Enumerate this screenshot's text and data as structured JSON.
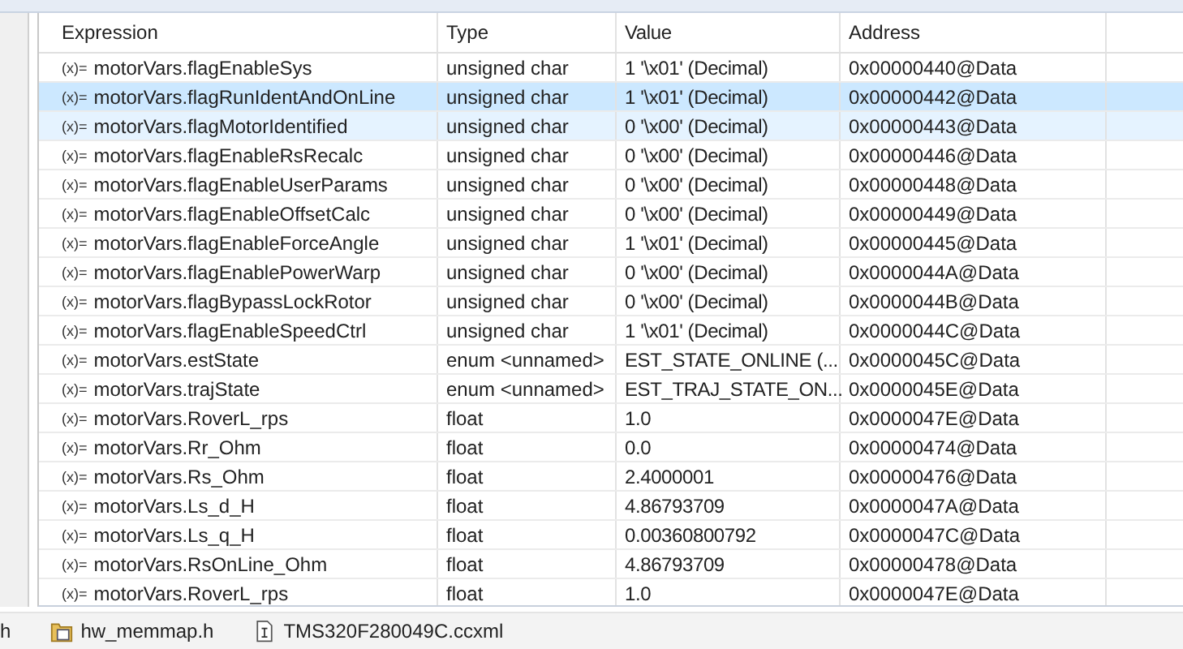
{
  "table": {
    "columns": [
      "Expression",
      "Type",
      "Value",
      "Address"
    ],
    "rows": [
      {
        "marker": "(x)=",
        "expression": "motorVars.flagEnableSys",
        "type": "unsigned char",
        "value": "1 '\\x01' (Decimal)",
        "address": "0x00000440@Data",
        "selected": false,
        "hovered": false
      },
      {
        "marker": "(x)=",
        "expression": "motorVars.flagRunIdentAndOnLine",
        "type": "unsigned char",
        "value": "1 '\\x01' (Decimal)",
        "address": "0x00000442@Data",
        "selected": true,
        "hovered": false
      },
      {
        "marker": "(x)=",
        "expression": "motorVars.flagMotorIdentified",
        "type": "unsigned char",
        "value": "0 '\\x00' (Decimal)",
        "address": "0x00000443@Data",
        "selected": false,
        "hovered": true
      },
      {
        "marker": "(x)=",
        "expression": "motorVars.flagEnableRsRecalc",
        "type": "unsigned char",
        "value": "0 '\\x00' (Decimal)",
        "address": "0x00000446@Data",
        "selected": false,
        "hovered": false
      },
      {
        "marker": "(x)=",
        "expression": "motorVars.flagEnableUserParams",
        "type": "unsigned char",
        "value": "0 '\\x00' (Decimal)",
        "address": "0x00000448@Data",
        "selected": false,
        "hovered": false
      },
      {
        "marker": "(x)=",
        "expression": "motorVars.flagEnableOffsetCalc",
        "type": "unsigned char",
        "value": "0 '\\x00' (Decimal)",
        "address": "0x00000449@Data",
        "selected": false,
        "hovered": false
      },
      {
        "marker": "(x)=",
        "expression": "motorVars.flagEnableForceAngle",
        "type": "unsigned char",
        "value": "1 '\\x01' (Decimal)",
        "address": "0x00000445@Data",
        "selected": false,
        "hovered": false
      },
      {
        "marker": "(x)=",
        "expression": "motorVars.flagEnablePowerWarp",
        "type": "unsigned char",
        "value": "0 '\\x00' (Decimal)",
        "address": "0x0000044A@Data",
        "selected": false,
        "hovered": false
      },
      {
        "marker": "(x)=",
        "expression": "motorVars.flagBypassLockRotor",
        "type": "unsigned char",
        "value": "0 '\\x00' (Decimal)",
        "address": "0x0000044B@Data",
        "selected": false,
        "hovered": false
      },
      {
        "marker": "(x)=",
        "expression": "motorVars.flagEnableSpeedCtrl",
        "type": "unsigned char",
        "value": "1 '\\x01' (Decimal)",
        "address": "0x0000044C@Data",
        "selected": false,
        "hovered": false
      },
      {
        "marker": "(x)=",
        "expression": "motorVars.estState",
        "type": "enum <unnamed>",
        "value": "EST_STATE_ONLINE (...",
        "address": "0x0000045C@Data",
        "selected": false,
        "hovered": false
      },
      {
        "marker": "(x)=",
        "expression": "motorVars.trajState",
        "type": "enum <unnamed>",
        "value": "EST_TRAJ_STATE_ON...",
        "address": "0x0000045E@Data",
        "selected": false,
        "hovered": false
      },
      {
        "marker": "(x)=",
        "expression": "motorVars.RoverL_rps",
        "type": "float",
        "value": "1.0",
        "address": "0x0000047E@Data",
        "selected": false,
        "hovered": false
      },
      {
        "marker": "(x)=",
        "expression": "motorVars.Rr_Ohm",
        "type": "float",
        "value": "0.0",
        "address": "0x00000474@Data",
        "selected": false,
        "hovered": false
      },
      {
        "marker": "(x)=",
        "expression": "motorVars.Rs_Ohm",
        "type": "float",
        "value": "2.4000001",
        "address": "0x00000476@Data",
        "selected": false,
        "hovered": false
      },
      {
        "marker": "(x)=",
        "expression": "motorVars.Ls_d_H",
        "type": "float",
        "value": "4.86793709",
        "address": "0x0000047A@Data",
        "selected": false,
        "hovered": false
      },
      {
        "marker": "(x)=",
        "expression": "motorVars.Ls_q_H",
        "type": "float",
        "value": "0.00360800792",
        "address": "0x0000047C@Data",
        "selected": false,
        "hovered": false
      },
      {
        "marker": "(x)=",
        "expression": "motorVars.RsOnLine_Ohm",
        "type": "float",
        "value": "4.86793709",
        "address": "0x00000478@Data",
        "selected": false,
        "hovered": false
      },
      {
        "marker": "(x)=",
        "expression": "motorVars.RoverL_rps",
        "type": "float",
        "value": "1.0",
        "address": "0x0000047E@Data",
        "selected": false,
        "hovered": false
      }
    ]
  },
  "editor_tabs": [
    {
      "label": "h",
      "kind": "partial"
    },
    {
      "label": "hw_memmap.h",
      "kind": "header"
    },
    {
      "label": "TMS320F280049C.ccxml",
      "kind": "config"
    }
  ]
}
